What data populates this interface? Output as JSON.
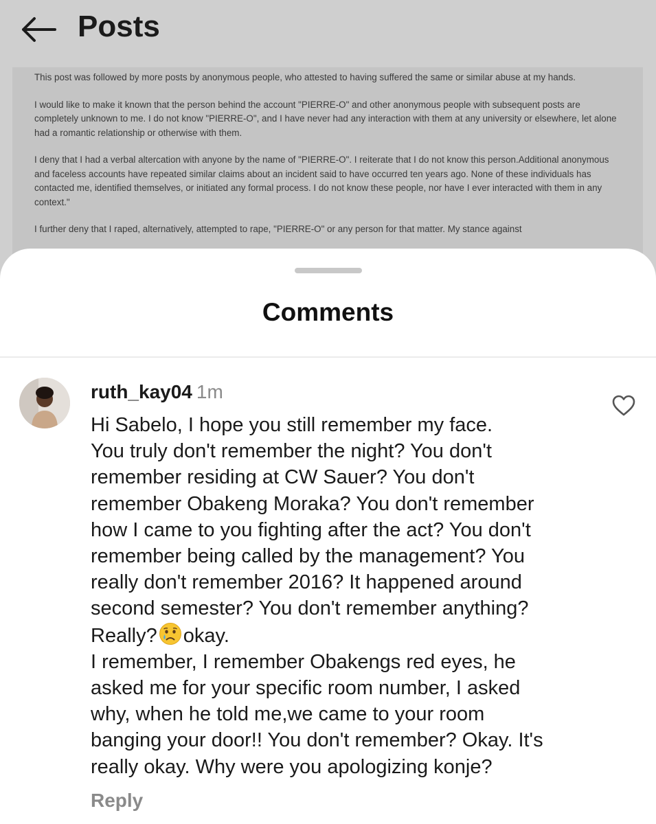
{
  "header": {
    "title": "Posts",
    "back_icon": "arrow-left-icon"
  },
  "post_document": {
    "paragraphs": [
      "This post was followed by more posts by anonymous people, who attested to having suffered the same or similar abuse at my hands.",
      "I would like to make it known that the person behind the account \"PIERRE-O\" and other anonymous people with subsequent posts are completely unknown to me. I do not know \"PIERRE-O\", and I have never had any interaction with them at any university or elsewhere, let alone had a romantic relationship or otherwise with them.",
      "I deny that I had a verbal altercation with anyone by the name of \"PIERRE-O\". I reiterate that I do not know this person.Additional anonymous and faceless accounts have repeated similar claims about an incident said to have occurred ten years ago. None of these individuals has contacted me, identified themselves, or initiated any formal process. I do not know these people, nor have I ever interacted with them in any context.\"",
      "I further deny that I raped, alternatively, attempted to rape, \"PIERRE-O\" or any person for that matter. My stance against"
    ]
  },
  "comments_sheet": {
    "title": "Comments",
    "comment": {
      "username": "ruth_kay04",
      "time": "1m",
      "lines": [
        "Hi Sabelo, I hope you still remember my face.",
        "You truly don't remember the night? You don't",
        "remember residing at CW Sauer? You don't",
        "remember Obakeng Moraka? You don't remember",
        "how I came to you fighting after the act? You don't",
        "remember being called by the management? You",
        "really don't remember 2016? It happened around",
        "second semester? You don't remember anything?"
      ],
      "emoji_line_before": "Really?",
      "emoji_icon": "crying-face-emoji-icon",
      "emoji_line_after": "okay.",
      "lines_after": [
        "I remember,  I remember Obakengs red eyes, he",
        "asked me for your specific room number, I asked",
        "why, when he told me,we came to your room",
        "banging your door!! You don't remember? Okay. It's",
        "really okay. Why were you apologizing konje?"
      ],
      "reply_label": "Reply",
      "like_icon": "heart-outline-icon"
    }
  }
}
